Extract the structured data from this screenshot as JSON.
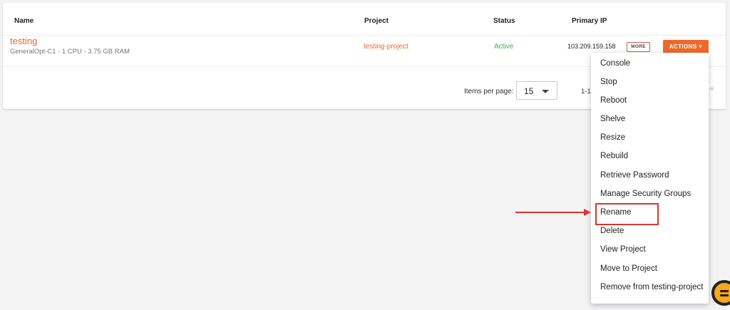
{
  "table": {
    "headers": {
      "name": "Name",
      "project": "Project",
      "status": "Status",
      "primary_ip": "Primary IP"
    },
    "rows": [
      {
        "name": "testing",
        "flavor": "GeneralOpt-C1 - 1 CPU - 3.75 GB RAM",
        "project": "testing-project",
        "status": "Active",
        "primary_ip": "103.209.159.158",
        "more_label": "MORE",
        "actions_label": "ACTIONS ˅"
      }
    ]
  },
  "pagination": {
    "items_per_page_label": "Items per page:",
    "items_per_page_value": "15",
    "range_text": "1-1",
    "last_page_icon": "⇥"
  },
  "actions_menu": {
    "items": [
      "Console",
      "Stop",
      "Reboot",
      "Shelve",
      "Resize",
      "Rebuild",
      "Retrieve Password",
      "Manage Security Groups",
      "Rename",
      "Delete",
      "View Project",
      "Move to Project",
      "Remove from testing-project"
    ],
    "highlighted_item": "Rename"
  },
  "colors": {
    "accent": "#ee6a2a",
    "link": "#e8692e",
    "status_active": "#3fae5c",
    "annotation": "#e0332b"
  }
}
